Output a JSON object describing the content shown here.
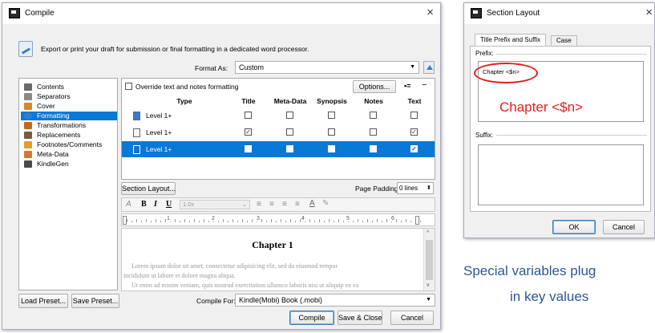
{
  "compile": {
    "title": "Compile",
    "close": "×",
    "header_text": "Export or print your draft for submission or final formatting in a dedicated word processor.",
    "format_as_label": "Format As:",
    "format_as_value": "Custom",
    "sidebar": [
      {
        "label": "Contents",
        "icon": "contents-icon",
        "color": "#6a6a6a"
      },
      {
        "label": "Separators",
        "icon": "separators-icon",
        "color": "#8a8a8a"
      },
      {
        "label": "Cover",
        "icon": "cover-icon",
        "color": "#d7882b"
      },
      {
        "label": "Formatting",
        "icon": "formatting-icon",
        "color": "#2f7fd0"
      },
      {
        "label": "Transformations",
        "icon": "transformations-icon",
        "color": "#c56a1c"
      },
      {
        "label": "Replacements",
        "icon": "replacements-icon",
        "color": "#7a5a3a"
      },
      {
        "label": "Footnotes/Comments",
        "icon": "footnotes-icon",
        "color": "#e0a030"
      },
      {
        "label": "Meta-Data",
        "icon": "metadata-icon",
        "color": "#d07a30"
      },
      {
        "label": "KindleGen",
        "icon": "kindlegen-icon",
        "color": "#4a4a4a"
      }
    ],
    "selected_sidebar": "Formatting",
    "override_label": "Override text and notes formatting",
    "options_button": "Options...",
    "plus_minus": [
      "•=",
      "−"
    ],
    "table": {
      "headers": [
        "Type",
        "Title",
        "Meta-Data",
        "Synopsis",
        "Notes",
        "Text"
      ],
      "rows": [
        {
          "type": "Level 1+",
          "icon": "folder-icon",
          "checks": [
            false,
            false,
            false,
            false,
            false
          ]
        },
        {
          "type": "Level 1+",
          "icon": "document-stack-icon",
          "checks": [
            true,
            false,
            false,
            false,
            true
          ]
        },
        {
          "type": "Level 1+",
          "icon": "document-icon",
          "checks": [
            false,
            false,
            false,
            false,
            true
          ],
          "selected": true
        }
      ]
    },
    "section_layout_button": "Section Layout...",
    "page_padding_label": "Page Padding:",
    "page_padding_value": "0 lines",
    "toolbar": {
      "bold": "B",
      "italic": "I",
      "underline": "U",
      "zoom": "1.0x"
    },
    "ruler_numbers": [
      "1",
      "2",
      "3",
      "4",
      "5",
      "6"
    ],
    "preview": {
      "heading": "Chapter 1",
      "line1": "Lorem ipsum dolor sit amet, consectetur adipisicing elit, sed do eiusmod tempor",
      "line2": "incididunt ut labore et dolore magna aliqua.",
      "line3": "Ut enim ad minim veniam, quis nostrud exercitation ullamco laboris nisi ut aliquip ex ea"
    },
    "load_preset": "Load Preset...",
    "save_preset": "Save Preset...",
    "compile_for_label": "Compile For:",
    "compile_for_value": "Kindle(Mobi) Book (.mobi)",
    "compile_button": "Compile",
    "save_close_button": "Save & Close",
    "cancel_button": "Cancel"
  },
  "section_layout": {
    "title": "Section Layout",
    "close": "×",
    "tabs": [
      "Title Prefix and Suffix",
      "Case"
    ],
    "prefix_label": "Prefix:",
    "prefix_value": "Chapter <$n>",
    "prefix_callout": "Chapter <$n>",
    "suffix_label": "Suffix:",
    "ok_button": "OK",
    "cancel_button": "Cancel"
  },
  "caption": {
    "line1": "Special variables plug",
    "line2": "in key values"
  },
  "colors": {
    "selection_blue": "#0a78d7",
    "callout_red": "#e0201a",
    "title_blue": "#2b5797"
  }
}
